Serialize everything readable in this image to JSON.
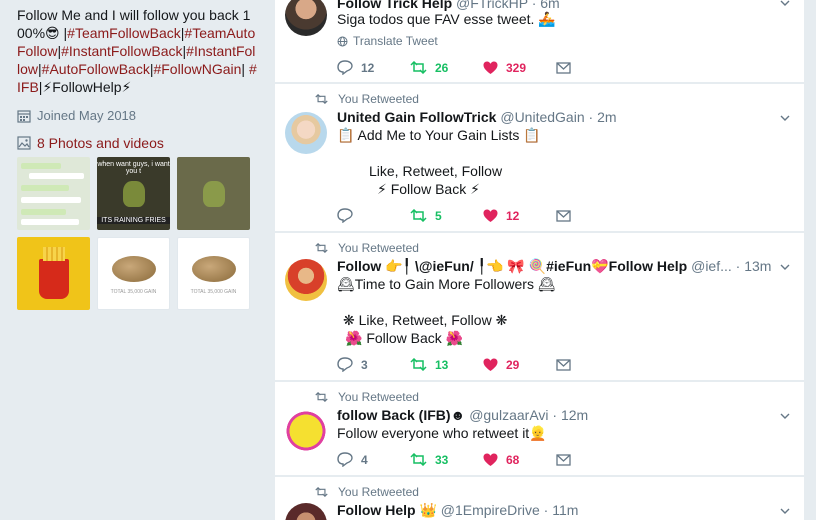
{
  "profile": {
    "bio_lines": [
      {
        "text": "Follow Me and I will follow you back",
        "hashtag": false
      },
      {
        "text": "100%😎 |",
        "hashtag": false
      }
    ],
    "bio_segments": [
      {
        "text": "Follow Me and I will follow you back 100%😎 |",
        "ht": false
      },
      {
        "text": "#TeamFollowBack",
        "ht": true
      },
      {
        "text": "|",
        "ht": false
      },
      {
        "text": "#TeamAutoFollow",
        "ht": true
      },
      {
        "text": "|",
        "ht": false
      },
      {
        "text": "#InstantFollowBack",
        "ht": true
      },
      {
        "text": "|",
        "ht": false
      },
      {
        "text": "#InstantFollow",
        "ht": true
      },
      {
        "text": "|",
        "ht": false
      },
      {
        "text": "#AutoFollowBack",
        "ht": true
      },
      {
        "text": "|",
        "ht": false
      },
      {
        "text": "#FollowNGain",
        "ht": true
      },
      {
        "text": "| ",
        "ht": false
      },
      {
        "text": "#IFB",
        "ht": true
      },
      {
        "text": "|⚡FollowHelp⚡",
        "ht": false
      }
    ],
    "joined": "Joined May 2018",
    "photos_link": "8 Photos and videos",
    "thumb_captions": {
      "t2_top": "when want guys, i want you t",
      "t2_bottom": "ITS RAINING FRIES",
      "t5_text": "TOTAL 35,000 GAIN"
    }
  },
  "tweets": [
    {
      "retweeted_label": "",
      "name": "Follow Trick Help",
      "handle": "@FTrickHP",
      "time": "6m",
      "body_lines": [
        "Siga todos que FAV esse tweet. 🚣"
      ],
      "translate": "Translate Tweet",
      "replies": "12",
      "retweets": "26",
      "likes": "329"
    },
    {
      "retweeted_label": "You Retweeted",
      "name": "United Gain FollowTrick",
      "handle": "@UnitedGain",
      "time": "2m",
      "body_lines": [
        "📋 Add Me to Your Gain Lists 📋",
        "",
        "Like, Retweet, Follow",
        "⚡ Follow Back ⚡"
      ],
      "replies": "",
      "retweets": "5",
      "likes": "12"
    },
    {
      "retweeted_label": "You Retweeted",
      "name": "Follow 👉╿ \\@ieFun/ ╿👈 🎀 🍭#ieFun💝Follow Help",
      "handle": "@ief...",
      "time": "13m",
      "body_lines": [
        "🕰Time to Gain More Followers 🕰",
        "",
        "❋ Like, Retweet, Follow ❋",
        "🌺 Follow Back 🌺"
      ],
      "replies": "3",
      "retweets": "13",
      "likes": "29"
    },
    {
      "retweeted_label": "You Retweeted",
      "name": "follow Back (IFB)☻",
      "handle": "@gulzaarAvi",
      "time": "12m",
      "body_lines": [
        "Follow everyone who retweet it👱"
      ],
      "replies": "4",
      "retweets": "33",
      "likes": "68"
    },
    {
      "retweeted_label": "You Retweeted",
      "name": "Follow Help 👑",
      "handle": "@1EmpireDrive",
      "time": "11m",
      "body_lines": [],
      "replies": "",
      "retweets": "",
      "likes": ""
    }
  ],
  "colors": {
    "accent_link": "#8b1a1a",
    "retweet": "#17bf63",
    "like": "#e0245e",
    "muted": "#657786"
  }
}
